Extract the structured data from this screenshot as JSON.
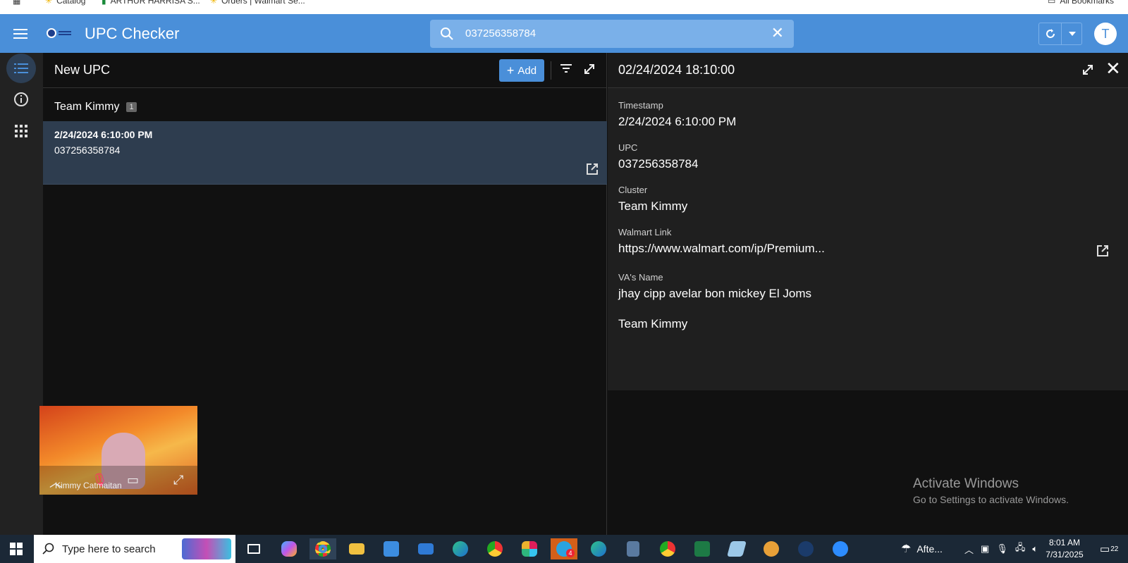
{
  "bookmarks": {
    "items": [
      "Catalog",
      "ARTHUR HARRISA S...",
      "Orders | Walmart Se..."
    ],
    "all": "All Bookmarks"
  },
  "header": {
    "title": "UPC Checker",
    "search_value": "037256358784",
    "avatar": "T"
  },
  "left": {
    "title": "New UPC",
    "add_label": "Add",
    "group_name": "Team Kimmy",
    "group_count": "1",
    "rows": [
      {
        "date": "2/24/2024 6:10:00 PM",
        "upc": "037256358784"
      }
    ]
  },
  "detail": {
    "title": "02/24/2024 18:10:00",
    "fields": [
      {
        "label": "Timestamp",
        "value": "2/24/2024 6:10:00 PM"
      },
      {
        "label": "UPC",
        "value": "037256358784"
      },
      {
        "label": "Cluster",
        "value": "Team Kimmy"
      },
      {
        "label": "Walmart Link",
        "value": "https://www.walmart.com/ip/Premium..."
      },
      {
        "label": "VA's Name",
        "value": "jhay cipp avelar bon mickey El Joms"
      }
    ],
    "footer": "Team Kimmy"
  },
  "video": {
    "name": "Kimmy Catmaitan"
  },
  "watermark": {
    "line1": "Activate Windows",
    "line2": "Go to Settings to activate Windows."
  },
  "taskbar": {
    "search_placeholder": "Type here to search",
    "badge": "4",
    "weather": "Afte...",
    "time": "8:01 AM",
    "date": "7/31/2025",
    "notif": "22"
  },
  "colors": {
    "accent": "#4a8fd9",
    "selected_row": "#2e3d4f",
    "panel": "#1f1f1f"
  }
}
